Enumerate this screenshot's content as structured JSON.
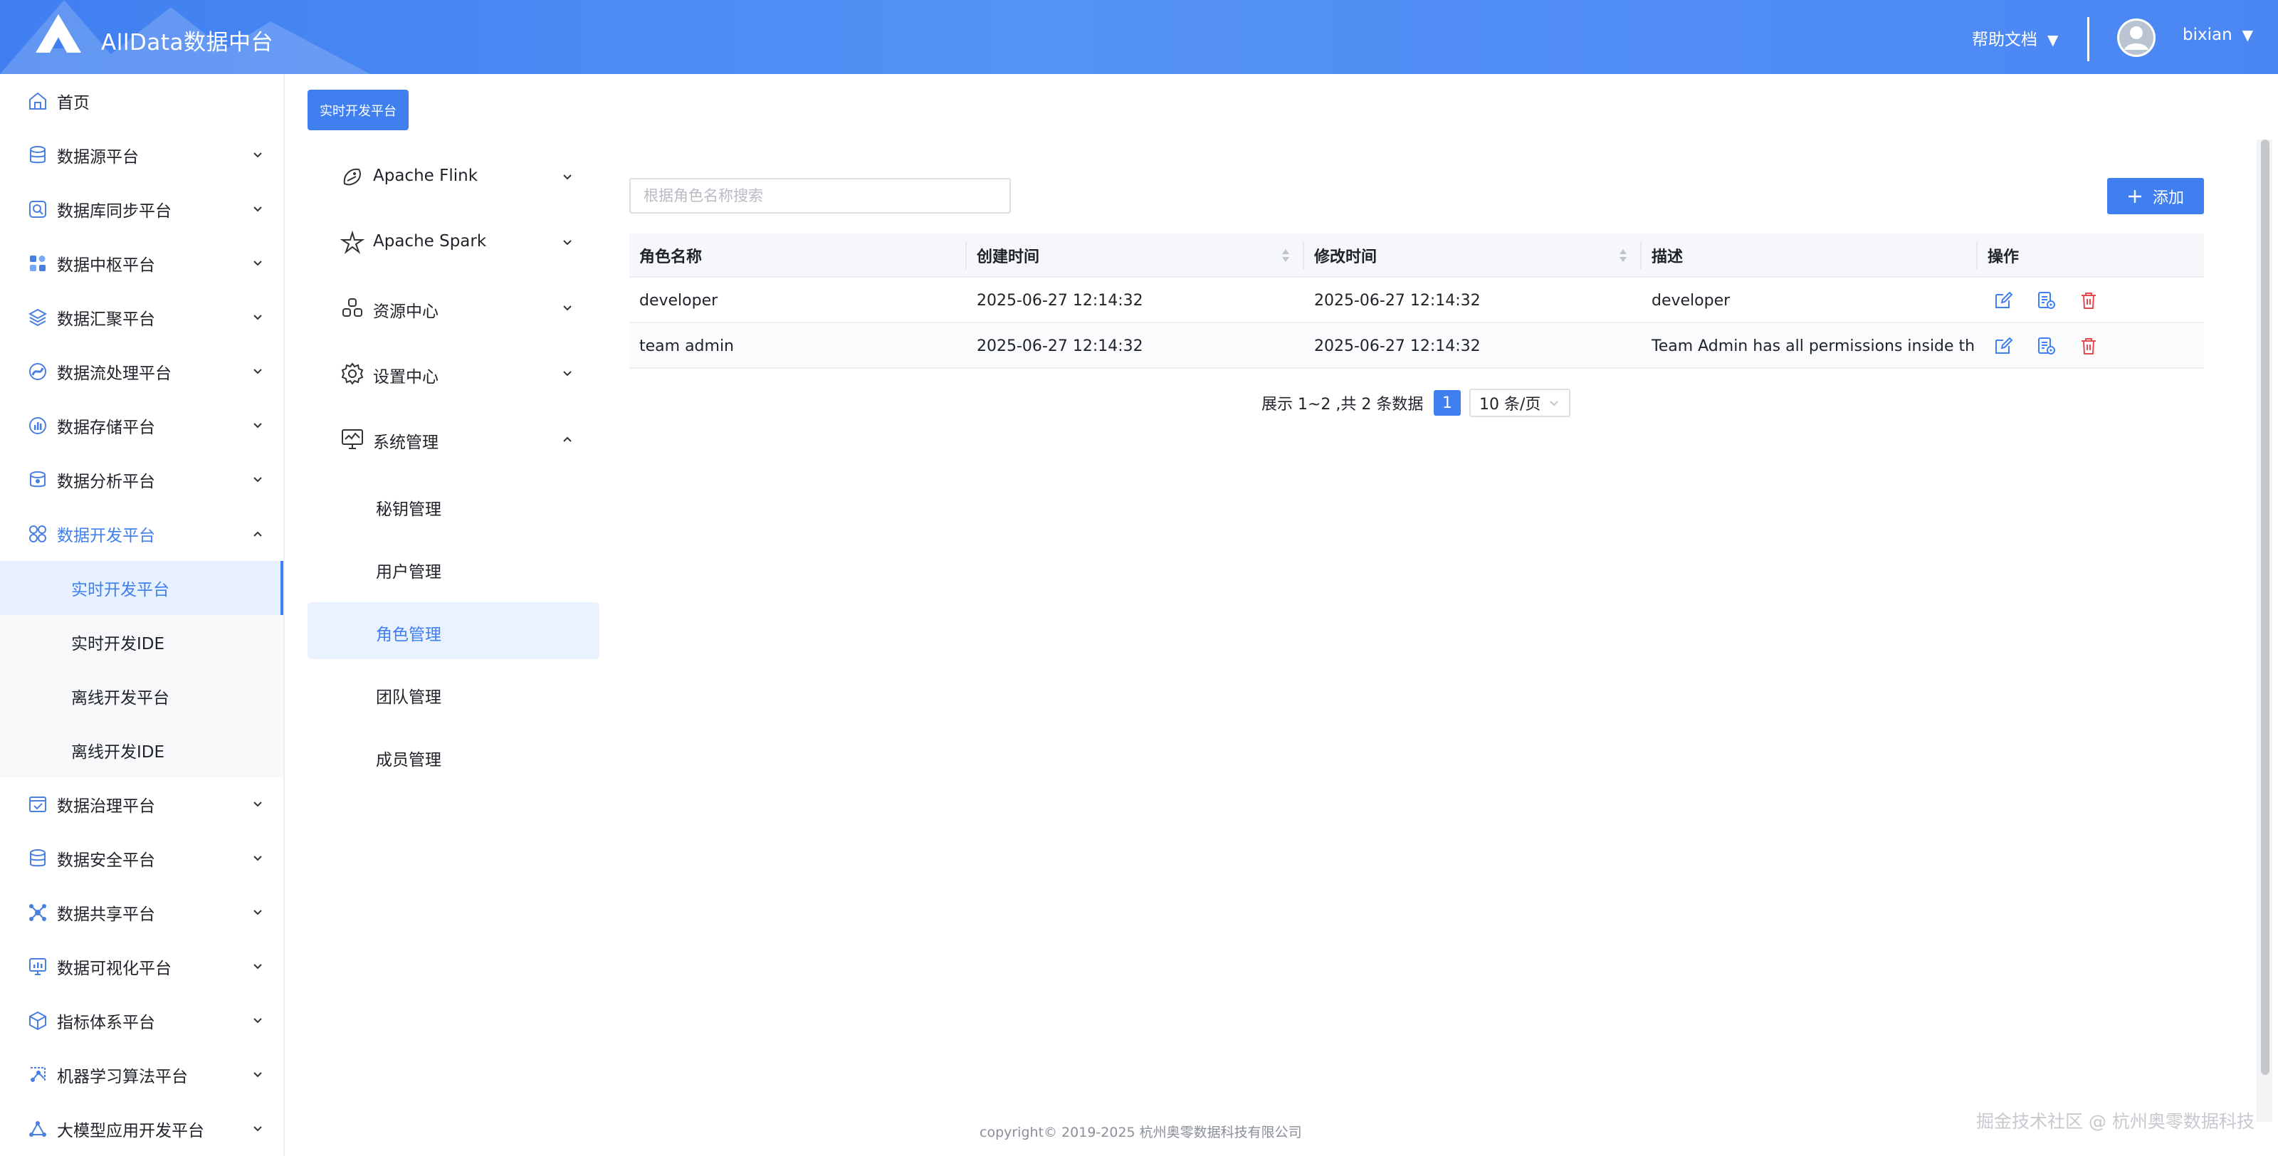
{
  "app": {
    "title": "AllData数据中台"
  },
  "header": {
    "help_label": "帮助文档",
    "help_caret": "▼",
    "user_name": "bixian",
    "user_caret": "▼"
  },
  "sidebar": {
    "items": [
      {
        "label": "首页",
        "icon": "home-icon"
      },
      {
        "label": "数据源平台",
        "icon": "database-icon"
      },
      {
        "label": "数据库同步平台",
        "icon": "sync-icon"
      },
      {
        "label": "数据中枢平台",
        "icon": "grid-icon"
      },
      {
        "label": "数据汇聚平台",
        "icon": "layers-icon"
      },
      {
        "label": "数据流处理平台",
        "icon": "stream-icon"
      },
      {
        "label": "数据存储平台",
        "icon": "storage-icon"
      },
      {
        "label": "数据分析平台",
        "icon": "analysis-icon"
      },
      {
        "label": "数据开发平台",
        "icon": "dev-icon"
      },
      {
        "label": "实时开发平台"
      },
      {
        "label": "实时开发IDE"
      },
      {
        "label": "离线开发平台"
      },
      {
        "label": "离线开发IDE"
      },
      {
        "label": "数据治理平台",
        "icon": "governance-icon"
      },
      {
        "label": "数据安全平台",
        "icon": "security-icon"
      },
      {
        "label": "数据共享平台",
        "icon": "share-icon"
      },
      {
        "label": "数据可视化平台",
        "icon": "visualization-icon"
      },
      {
        "label": "指标体系平台",
        "icon": "cube-icon"
      },
      {
        "label": "机器学习算法平台",
        "icon": "ml-icon"
      },
      {
        "label": "大模型应用开发平台",
        "icon": "llm-icon"
      }
    ]
  },
  "breadcrumb_button": "实时开发平台",
  "submenu": {
    "groups": [
      {
        "label": "Apache Flink",
        "icon": "flink-icon"
      },
      {
        "label": "Apache Spark",
        "icon": "spark-icon"
      },
      {
        "label": "资源中心",
        "icon": "resource-icon"
      },
      {
        "label": "设置中心",
        "icon": "gear-icon"
      },
      {
        "label": "系统管理",
        "icon": "monitor-icon"
      }
    ],
    "leaves": [
      {
        "label": "秘钥管理"
      },
      {
        "label": "用户管理"
      },
      {
        "label": "角色管理"
      },
      {
        "label": "团队管理"
      },
      {
        "label": "成员管理"
      }
    ]
  },
  "search": {
    "placeholder": "根据角色名称搜索",
    "value": ""
  },
  "add_button": {
    "label": "添加",
    "icon": "plus-icon"
  },
  "table": {
    "columns": [
      "角色名称",
      "创建时间",
      "修改时间",
      "描述",
      "操作"
    ],
    "rows": [
      {
        "name": "developer",
        "created": "2025-06-27 12:14:32",
        "modified": "2025-06-27 12:14:32",
        "desc": "developer"
      },
      {
        "name": "team admin",
        "created": "2025-06-27 12:14:32",
        "modified": "2025-06-27 12:14:32",
        "desc": "Team Admin has all permissions inside th..."
      }
    ]
  },
  "pagination": {
    "summary": "展示 1~2 ,共 2 条数据",
    "current_page": "1",
    "page_size": "10 条/页"
  },
  "footer": {
    "copyright": "copyright© 2019-2025 杭州奥零数据科技有限公司"
  },
  "watermark": "掘金技术社区 @ 杭州奥零数据科技",
  "colors": {
    "primary": "#3f7ff0",
    "danger": "#e5484d",
    "header_gradient_start": "#3f7ff0",
    "header_gradient_end": "#4b87f3"
  }
}
